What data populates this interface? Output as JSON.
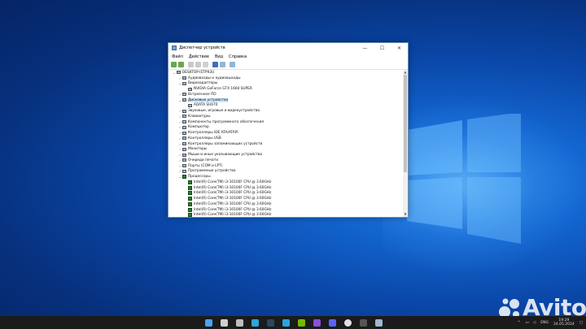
{
  "window": {
    "title": "Диспетчер устройств",
    "menu": [
      "Файл",
      "Действие",
      "Вид",
      "Справка"
    ],
    "controls": {
      "minimize": "—",
      "maximize": "☐",
      "close": "✕"
    }
  },
  "tree": [
    {
      "level": 0,
      "arrow": "v",
      "icon": "computer",
      "label": "DESKTOP-I5TP93U"
    },
    {
      "level": 1,
      "arrow": ">",
      "icon": "audio",
      "label": "Аудиовходы и аудиовыходы"
    },
    {
      "level": 1,
      "arrow": "v",
      "icon": "display",
      "label": "Видеоадаптеры"
    },
    {
      "level": 2,
      "arrow": "",
      "icon": "display",
      "label": "NVIDIA GeForce GTX 1660 SUPER"
    },
    {
      "level": 1,
      "arrow": ">",
      "icon": "firmware",
      "label": "Встроенное ПО"
    },
    {
      "level": 1,
      "arrow": "v",
      "icon": "disk",
      "label": "Дисковые устройства",
      "selected": true
    },
    {
      "level": 2,
      "arrow": "",
      "icon": "disk",
      "label": "ADATA SU670"
    },
    {
      "level": 1,
      "arrow": ">",
      "icon": "sound",
      "label": "Звуковые, игровые и видеоустройства"
    },
    {
      "level": 1,
      "arrow": ">",
      "icon": "keyboard",
      "label": "Клавиатуры"
    },
    {
      "level": 1,
      "arrow": ">",
      "icon": "software",
      "label": "Компоненты программного обеспечения"
    },
    {
      "level": 1,
      "arrow": ">",
      "icon": "computer",
      "label": "Компьютер"
    },
    {
      "level": 1,
      "arrow": ">",
      "icon": "ide",
      "label": "Контроллеры IDE ATA/ATAPI"
    },
    {
      "level": 1,
      "arrow": ">",
      "icon": "usb",
      "label": "Контроллеры USB"
    },
    {
      "level": 1,
      "arrow": ">",
      "icon": "storage",
      "label": "Контроллеры запоминающих устройств"
    },
    {
      "level": 1,
      "arrow": ">",
      "icon": "monitor",
      "label": "Мониторы"
    },
    {
      "level": 1,
      "arrow": ">",
      "icon": "mouse",
      "label": "Мыши и иные указывающие устройства"
    },
    {
      "level": 1,
      "arrow": ">",
      "icon": "print",
      "label": "Очереди печати"
    },
    {
      "level": 1,
      "arrow": ">",
      "icon": "port",
      "label": "Порты (COM и LPT)"
    },
    {
      "level": 1,
      "arrow": ">",
      "icon": "software",
      "label": "Программные устройства"
    },
    {
      "level": 1,
      "arrow": "v",
      "icon": "cpu",
      "label": "Процессоры"
    },
    {
      "level": 2,
      "arrow": "",
      "icon": "cpu",
      "label": "Intel(R) Core(TM) i3-10100F CPU @ 3.60GHz"
    },
    {
      "level": 2,
      "arrow": "",
      "icon": "cpu",
      "label": "Intel(R) Core(TM) i3-10100F CPU @ 3.60GHz"
    },
    {
      "level": 2,
      "arrow": "",
      "icon": "cpu",
      "label": "Intel(R) Core(TM) i3-10100F CPU @ 3.60GHz"
    },
    {
      "level": 2,
      "arrow": "",
      "icon": "cpu",
      "label": "Intel(R) Core(TM) i3-10100F CPU @ 3.60GHz"
    },
    {
      "level": 2,
      "arrow": "",
      "icon": "cpu",
      "label": "Intel(R) Core(TM) i3-10100F CPU @ 3.60GHz"
    },
    {
      "level": 2,
      "arrow": "",
      "icon": "cpu",
      "label": "Intel(R) Core(TM) i3-10100F CPU @ 3.60GHz"
    },
    {
      "level": 2,
      "arrow": "",
      "icon": "cpu",
      "label": "Intel(R) Core(TM) i3-10100F CPU @ 3.60GHz"
    }
  ],
  "taskbar": {
    "apps": [
      "windows-start",
      "search",
      "task-view",
      "edge",
      "steam",
      "telegram",
      "nvidia",
      "app-purple",
      "discord",
      "obs",
      "app-dark",
      "device-manager"
    ],
    "lang": "ENG",
    "time": "19:29",
    "date": "24.05.2024"
  },
  "watermark": {
    "brand": "Avito"
  },
  "colors": {
    "accent": "#0a5bc4",
    "selection": "#cce8ff",
    "taskbar": "#1b1b1b"
  }
}
